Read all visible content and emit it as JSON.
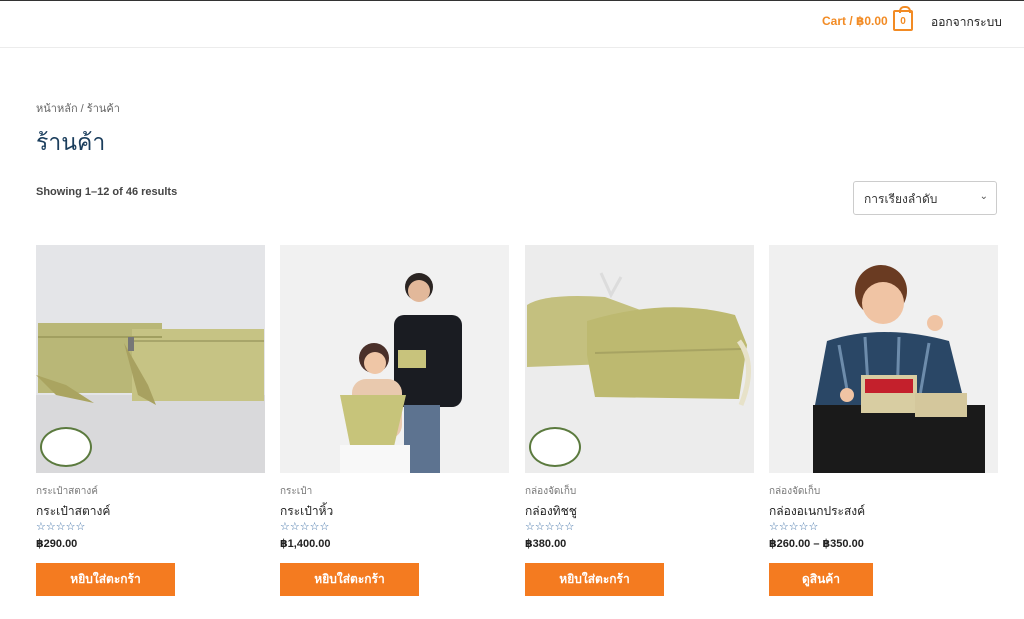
{
  "header": {
    "cart_label": "Cart / ฿0.00",
    "cart_count": "0",
    "logout_label": "ออกจากระบบ"
  },
  "breadcrumb": {
    "home": "หน้าหลัก",
    "separator": "/",
    "current": "ร้านค้า"
  },
  "page": {
    "title": "ร้านค้า",
    "result_count": "Showing 1–12 of 46 results",
    "orderby": "การเรียงลำดับ"
  },
  "products": [
    {
      "category": "กระเป๋าสตางค์",
      "name": "กระเป๋าสตางค์",
      "rating": "☆☆☆☆☆",
      "price": "฿290.00",
      "button": "หยิบใส่ตะกร้า"
    },
    {
      "category": "กระเป๋า",
      "name": "กระเป๋าหิ้ว",
      "rating": "☆☆☆☆☆",
      "price": "฿1,400.00",
      "button": "หยิบใส่ตะกร้า"
    },
    {
      "category": "กล่องจัดเก็บ",
      "name": "กล่องทิชชู",
      "rating": "☆☆☆☆☆",
      "price": "฿380.00",
      "button": "หยิบใส่ตะกร้า"
    },
    {
      "category": "กล่องจัดเก็บ",
      "name": "กล่องอเนกประสงค์",
      "rating": "☆☆☆☆☆",
      "price": "฿260.00 – ฿350.00",
      "button": "ดูสินค้า"
    }
  ],
  "colors": {
    "accent": "#f47b20",
    "title": "#1a3d5c"
  }
}
